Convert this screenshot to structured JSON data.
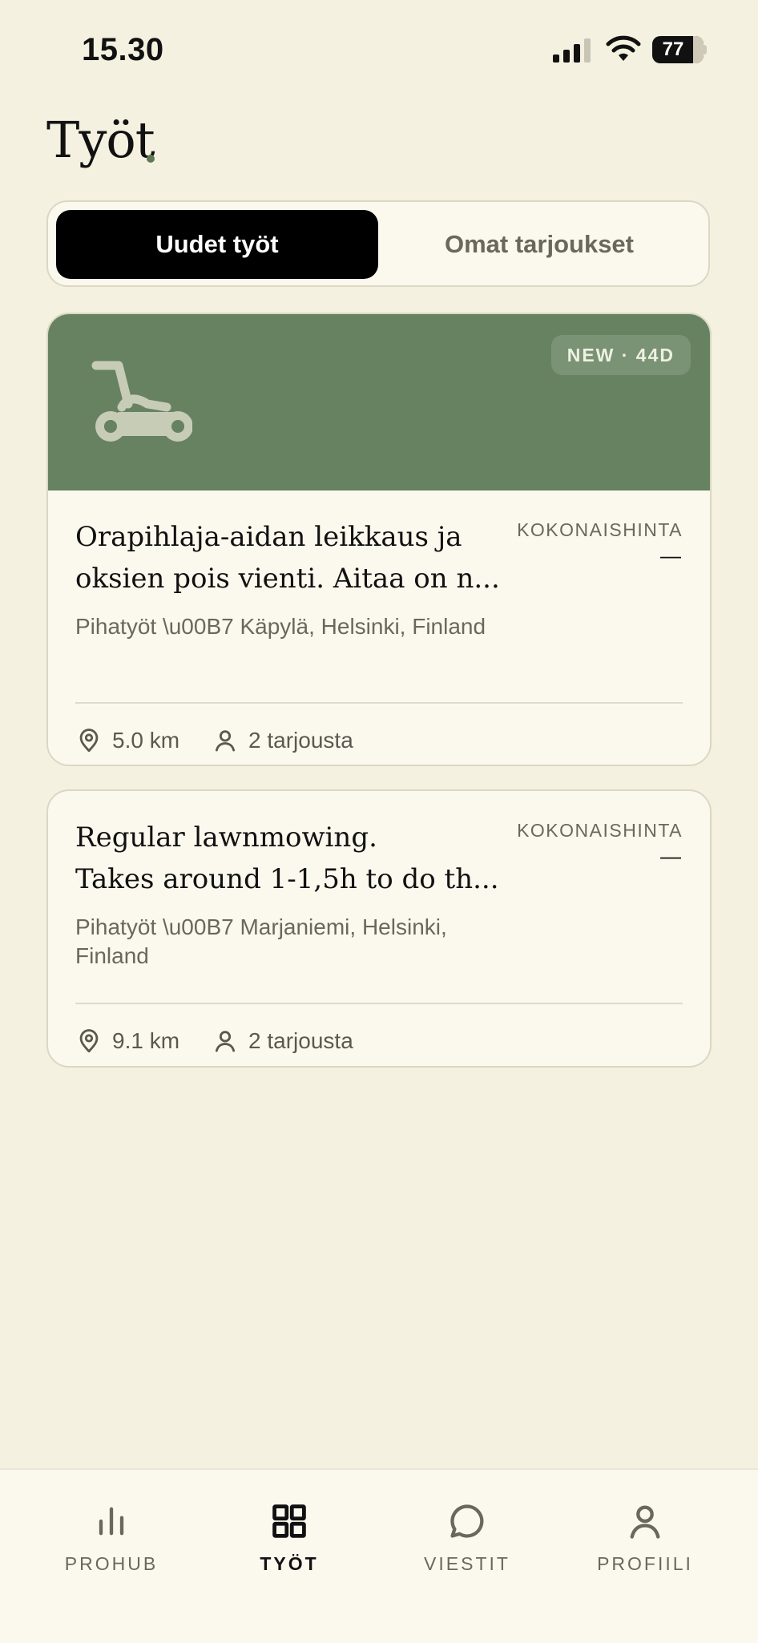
{
  "status_bar": {
    "time": "15.30",
    "battery": "77"
  },
  "page": {
    "title": "Työt"
  },
  "segments": {
    "active": "Uudet työt",
    "inactive": "Omat tarjoukset"
  },
  "jobs": [
    {
      "badge": "NEW · 44D",
      "icon": "lawn-mower-icon",
      "title": "Orapihlaja-aidan leikkaus ja\noksien pois vienti. Aitaa on n...",
      "price_label": "KOKONAISHINTA",
      "price_value": "—",
      "meta": "Pihatyöt \\u00B7 Käpylä, Helsinki, Finland",
      "distance": "5.0 km",
      "offers": "2 tarjousta"
    },
    {
      "title": "Regular lawnmowing.\nTakes around 1-1,5h to do th...",
      "price_label": "KOKONAISHINTA",
      "price_value": "—",
      "meta": "Pihatyöt \\u00B7 Marjaniemi, Helsinki, Finland",
      "distance": "9.1 km",
      "offers": "2 tarjousta"
    }
  ],
  "tabs": [
    {
      "label": "PROHUB",
      "icon": "bar-chart-icon"
    },
    {
      "label": "TYÖT",
      "icon": "grid-icon",
      "active": true
    },
    {
      "label": "VIESTIT",
      "icon": "chat-bubble-icon"
    },
    {
      "label": "PROFIILI",
      "icon": "person-icon"
    }
  ],
  "colors": {
    "background": "#f4f1e1",
    "card": "#fbf9ee",
    "banner_green": "#678261",
    "accent_dot": "#5d7a53",
    "active_segment": "#000000"
  }
}
